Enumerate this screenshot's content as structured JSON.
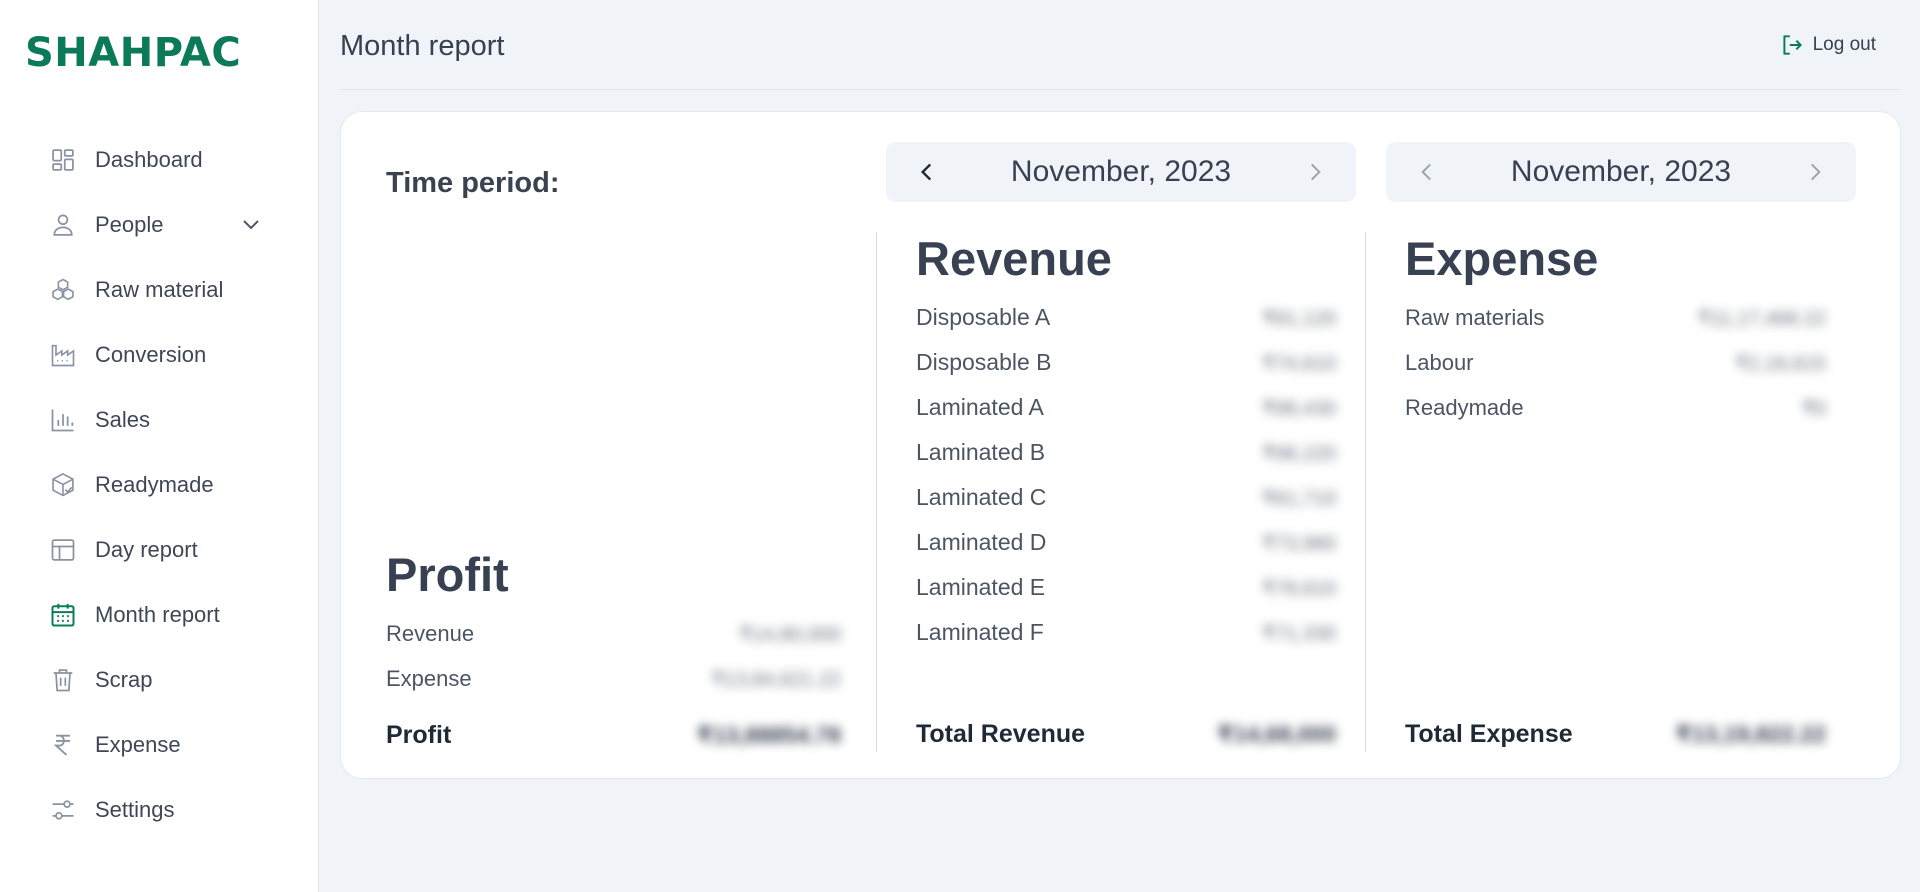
{
  "brand": "SHAHPAC",
  "colors": {
    "accent": "#0b7a5a",
    "icon": "#8a93a3"
  },
  "sidebar": {
    "items": [
      {
        "label": "Dashboard",
        "icon": "grid-icon"
      },
      {
        "label": "People",
        "icon": "user-icon",
        "expandable": true
      },
      {
        "label": "Raw material",
        "icon": "cubes-icon"
      },
      {
        "label": "Conversion",
        "icon": "factory-icon"
      },
      {
        "label": "Sales",
        "icon": "bar-chart-icon"
      },
      {
        "label": "Readymade",
        "icon": "package-icon"
      },
      {
        "label": "Day report",
        "icon": "table-icon"
      },
      {
        "label": "Month report",
        "icon": "calendar-icon",
        "active": true
      },
      {
        "label": "Scrap",
        "icon": "trash-icon"
      },
      {
        "label": "Expense",
        "icon": "rupee-icon"
      },
      {
        "label": "Settings",
        "icon": "sliders-icon"
      }
    ]
  },
  "header": {
    "title": "Month report",
    "logout_label": "Log out"
  },
  "card": {
    "time_period_label": "Time period:",
    "picker_left": {
      "label": "November, 2023"
    },
    "picker_right": {
      "label": "November, 2023"
    },
    "profit": {
      "title": "Profit",
      "rows": [
        {
          "label": "Revenue",
          "value": "₹14,80,000"
        },
        {
          "label": "Expense",
          "value": "₹13,84,621.22"
        }
      ],
      "total_label": "Profit",
      "total_value": "₹13,88854.78"
    },
    "revenue": {
      "title": "Revenue",
      "rows": [
        {
          "label": "Disposable A",
          "value": "₹81,120"
        },
        {
          "label": "Disposable B",
          "value": "₹74,610"
        },
        {
          "label": "Laminated A",
          "value": "₹98,430"
        },
        {
          "label": "Laminated B",
          "value": "₹96,220"
        },
        {
          "label": "Laminated C",
          "value": "₹61,710"
        },
        {
          "label": "Laminated D",
          "value": "₹73,980"
        },
        {
          "label": "Laminated E",
          "value": "₹78,610"
        },
        {
          "label": "Laminated F",
          "value": "₹71,330"
        }
      ],
      "total_label": "Total Revenue",
      "total_value": "₹14,68,000"
    },
    "expense": {
      "title": "Expense",
      "rows": [
        {
          "label": "Raw materials",
          "value": "₹11,17,468.22"
        },
        {
          "label": "Labour",
          "value": "₹2,16,615"
        },
        {
          "label": "Readymade",
          "value": "₹0"
        }
      ],
      "total_label": "Total Expense",
      "total_value": "₹13,19,822.22"
    }
  }
}
